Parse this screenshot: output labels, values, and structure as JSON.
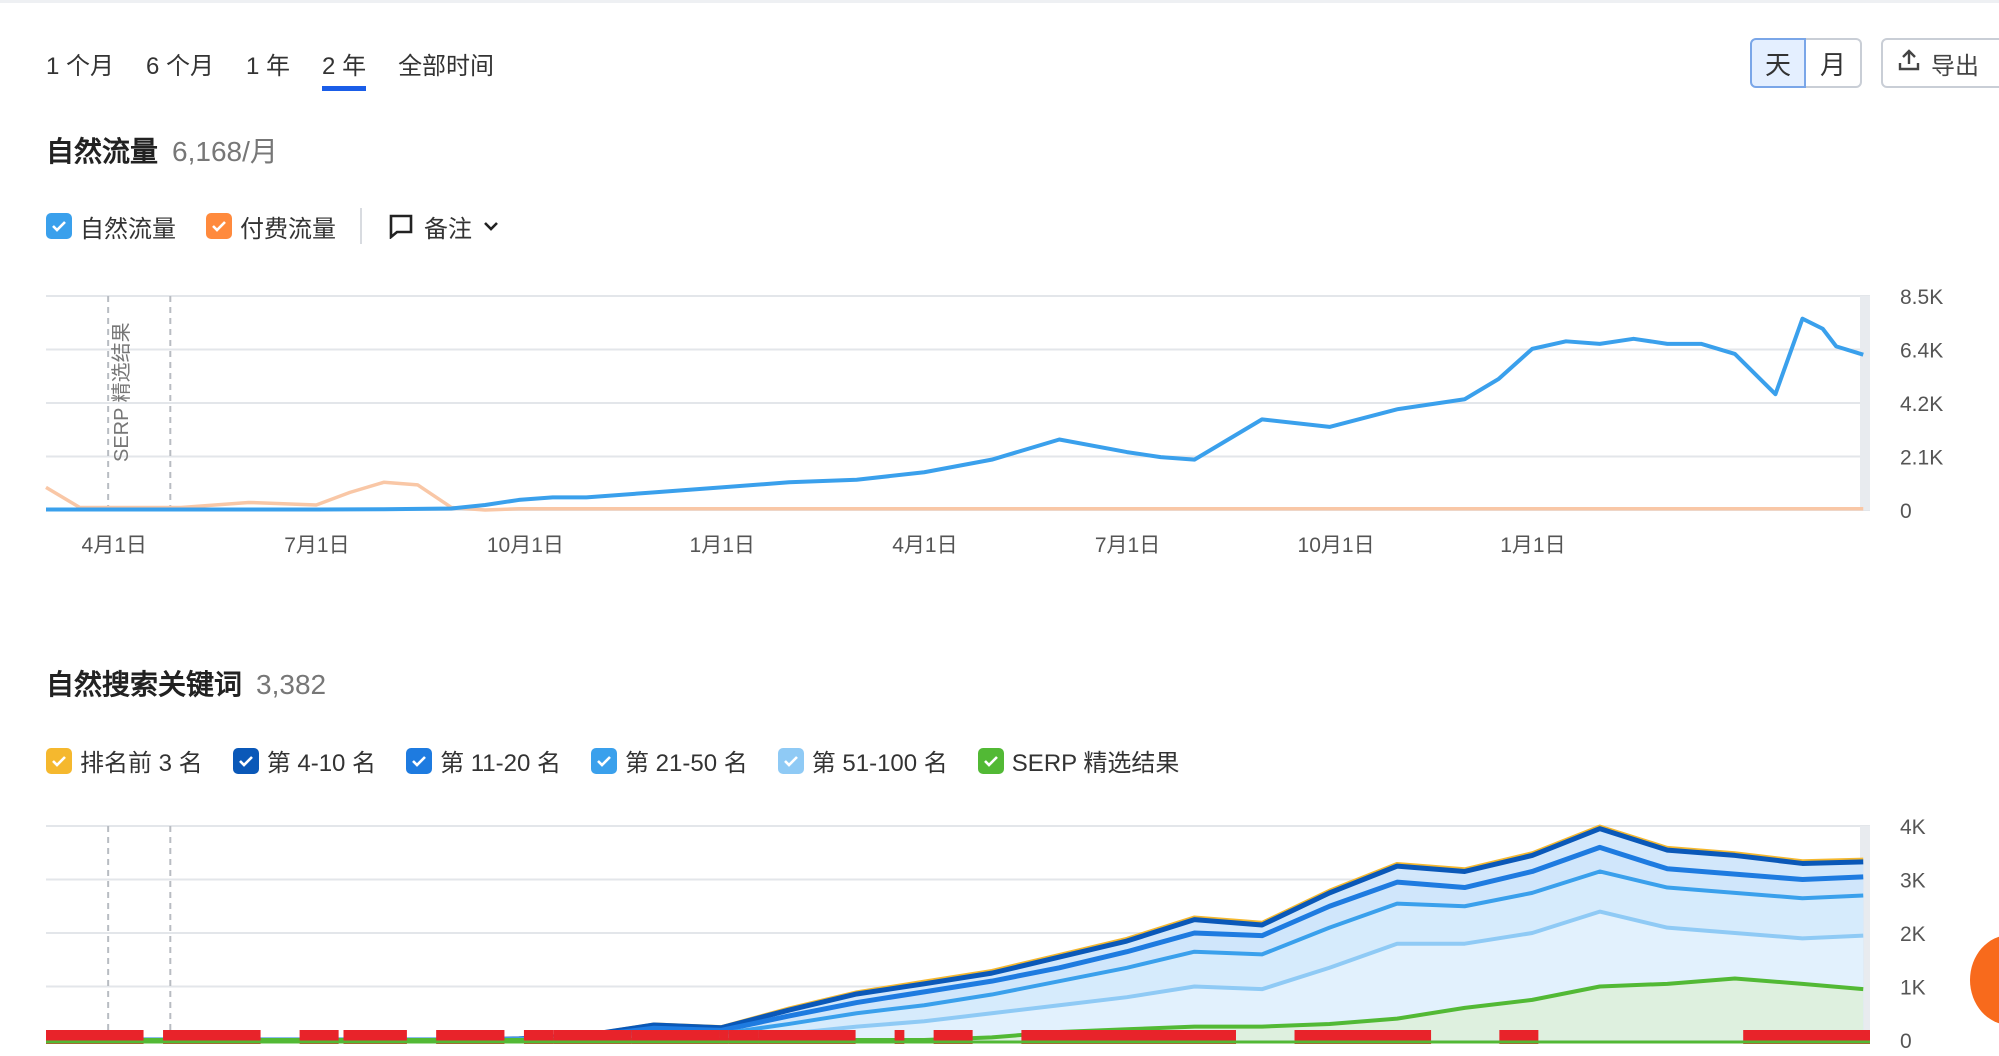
{
  "period_tabs": [
    "1 个月",
    "6 个月",
    "1 年",
    "2 年",
    "全部时间"
  ],
  "active_tab": "2 年",
  "granularity": {
    "day": "天",
    "month": "月",
    "selected": "天"
  },
  "export_label": "导出",
  "traffic": {
    "title": "自然流量",
    "value": "6,168/月",
    "legend": {
      "organic": "自然流量",
      "paid": "付费流量",
      "notes": "备注"
    },
    "colors": {
      "organic": "#3aa0ec",
      "paid": "#ff8a3d"
    },
    "chart_data": {
      "type": "line",
      "title": "",
      "x_ticks": [
        "4月1日",
        "7月1日",
        "10月1日",
        "1月1日",
        "4月1日",
        "7月1日",
        "10月1日",
        "1月1日"
      ],
      "y_ticks": [
        "8.5K",
        "6.4K",
        "4.2K",
        "2.1K",
        "0"
      ],
      "ylim": [
        0,
        8500
      ],
      "annotation": "SERP 精选结果",
      "series": [
        {
          "name": "自然流量",
          "x_month": [
            0,
            1,
            2,
            3,
            4,
            5,
            6,
            6.5,
            7,
            7.5,
            8,
            9,
            10,
            11,
            12,
            13,
            14,
            15,
            16,
            16.5,
            17,
            18,
            19,
            20,
            21,
            21.5,
            22,
            22.5,
            23,
            23.5,
            24,
            24.5,
            25,
            25.6,
            26,
            26.3,
            26.5,
            26.9
          ],
          "values": [
            20,
            20,
            20,
            20,
            20,
            30,
            60,
            200,
            400,
            500,
            500,
            700,
            900,
            1100,
            1200,
            1500,
            2000,
            2800,
            2300,
            2100,
            2000,
            3600,
            3300,
            4000,
            4400,
            5200,
            6400,
            6700,
            6600,
            6800,
            6600,
            6600,
            6200,
            4600,
            7600,
            7200,
            6500,
            6168
          ]
        },
        {
          "name": "付费流量",
          "x_month": [
            0,
            0.5,
            1,
            2,
            3,
            4,
            4.5,
            5,
            5.5,
            6,
            6.5,
            7,
            8,
            9,
            10,
            11,
            12,
            13,
            14,
            15,
            16,
            17,
            18,
            19,
            20,
            21,
            22,
            23,
            24,
            25,
            26,
            26.9
          ],
          "values": [
            900,
            100,
            100,
            100,
            300,
            200,
            700,
            1100,
            1000,
            100,
            0,
            50,
            50,
            50,
            50,
            50,
            50,
            50,
            50,
            50,
            50,
            50,
            50,
            50,
            50,
            50,
            50,
            50,
            50,
            50,
            50,
            50
          ]
        }
      ]
    }
  },
  "keywords": {
    "title": "自然搜索关键词",
    "value": "3,382",
    "legend": [
      {
        "label": "排名前 3 名",
        "color": "#f5b82e"
      },
      {
        "label": "第 4-10 名",
        "color": "#0a58b8"
      },
      {
        "label": "第 11-20 名",
        "color": "#1e7be0"
      },
      {
        "label": "第 21-50 名",
        "color": "#3aa0ec"
      },
      {
        "label": "第 51-100 名",
        "color": "#8fcaf5"
      },
      {
        "label": "SERP 精选结果",
        "color": "#52b935"
      }
    ],
    "chart_data": {
      "type": "area",
      "title": "",
      "y_ticks": [
        "4K",
        "3K",
        "2K",
        "1K",
        "0"
      ],
      "ylim": [
        0,
        4000
      ],
      "x_month": [
        0,
        1,
        2,
        3,
        4,
        5,
        6,
        7,
        8,
        9,
        10,
        11,
        12,
        13,
        14,
        15,
        16,
        17,
        18,
        19,
        20,
        21,
        22,
        23,
        24,
        25,
        26,
        26.9
      ],
      "series": [
        {
          "name": "排名前 3 名",
          "values": [
            0,
            0,
            0,
            0,
            0,
            0,
            0,
            20,
            100,
            300,
            250,
            600,
            900,
            1100,
            1300,
            1600,
            1900,
            2300,
            2200,
            2800,
            3300,
            3200,
            3500,
            4000,
            3600,
            3500,
            3350,
            3382
          ]
        },
        {
          "name": "第 4-10 名",
          "values": [
            0,
            0,
            0,
            0,
            0,
            0,
            0,
            20,
            90,
            280,
            230,
            560,
            860,
            1050,
            1250,
            1550,
            1850,
            2250,
            2150,
            2750,
            3250,
            3150,
            3450,
            3950,
            3550,
            3450,
            3300,
            3330
          ]
        },
        {
          "name": "第 11-20 名",
          "values": [
            0,
            0,
            0,
            0,
            0,
            0,
            0,
            15,
            70,
            220,
            180,
            450,
            700,
            900,
            1100,
            1350,
            1650,
            2000,
            1950,
            2500,
            2950,
            2850,
            3150,
            3600,
            3200,
            3100,
            3000,
            3050
          ]
        },
        {
          "name": "第 21-50 名",
          "values": [
            0,
            0,
            0,
            0,
            0,
            0,
            0,
            10,
            50,
            150,
            120,
            300,
            500,
            650,
            850,
            1100,
            1350,
            1650,
            1600,
            2100,
            2550,
            2500,
            2750,
            3150,
            2850,
            2750,
            2650,
            2700
          ]
        },
        {
          "name": "第 51-100 名",
          "values": [
            0,
            0,
            0,
            0,
            0,
            0,
            0,
            5,
            20,
            60,
            50,
            120,
            250,
            350,
            500,
            650,
            800,
            1000,
            950,
            1350,
            1800,
            1800,
            2000,
            2400,
            2100,
            2000,
            1900,
            1950
          ]
        },
        {
          "name": "SERP 精选结果",
          "values": [
            0,
            0,
            0,
            0,
            0,
            0,
            0,
            0,
            0,
            0,
            0,
            0,
            0,
            0,
            50,
            150,
            200,
            250,
            250,
            300,
            400,
            600,
            750,
            1000,
            1050,
            1150,
            1050,
            950
          ]
        }
      ]
    }
  }
}
